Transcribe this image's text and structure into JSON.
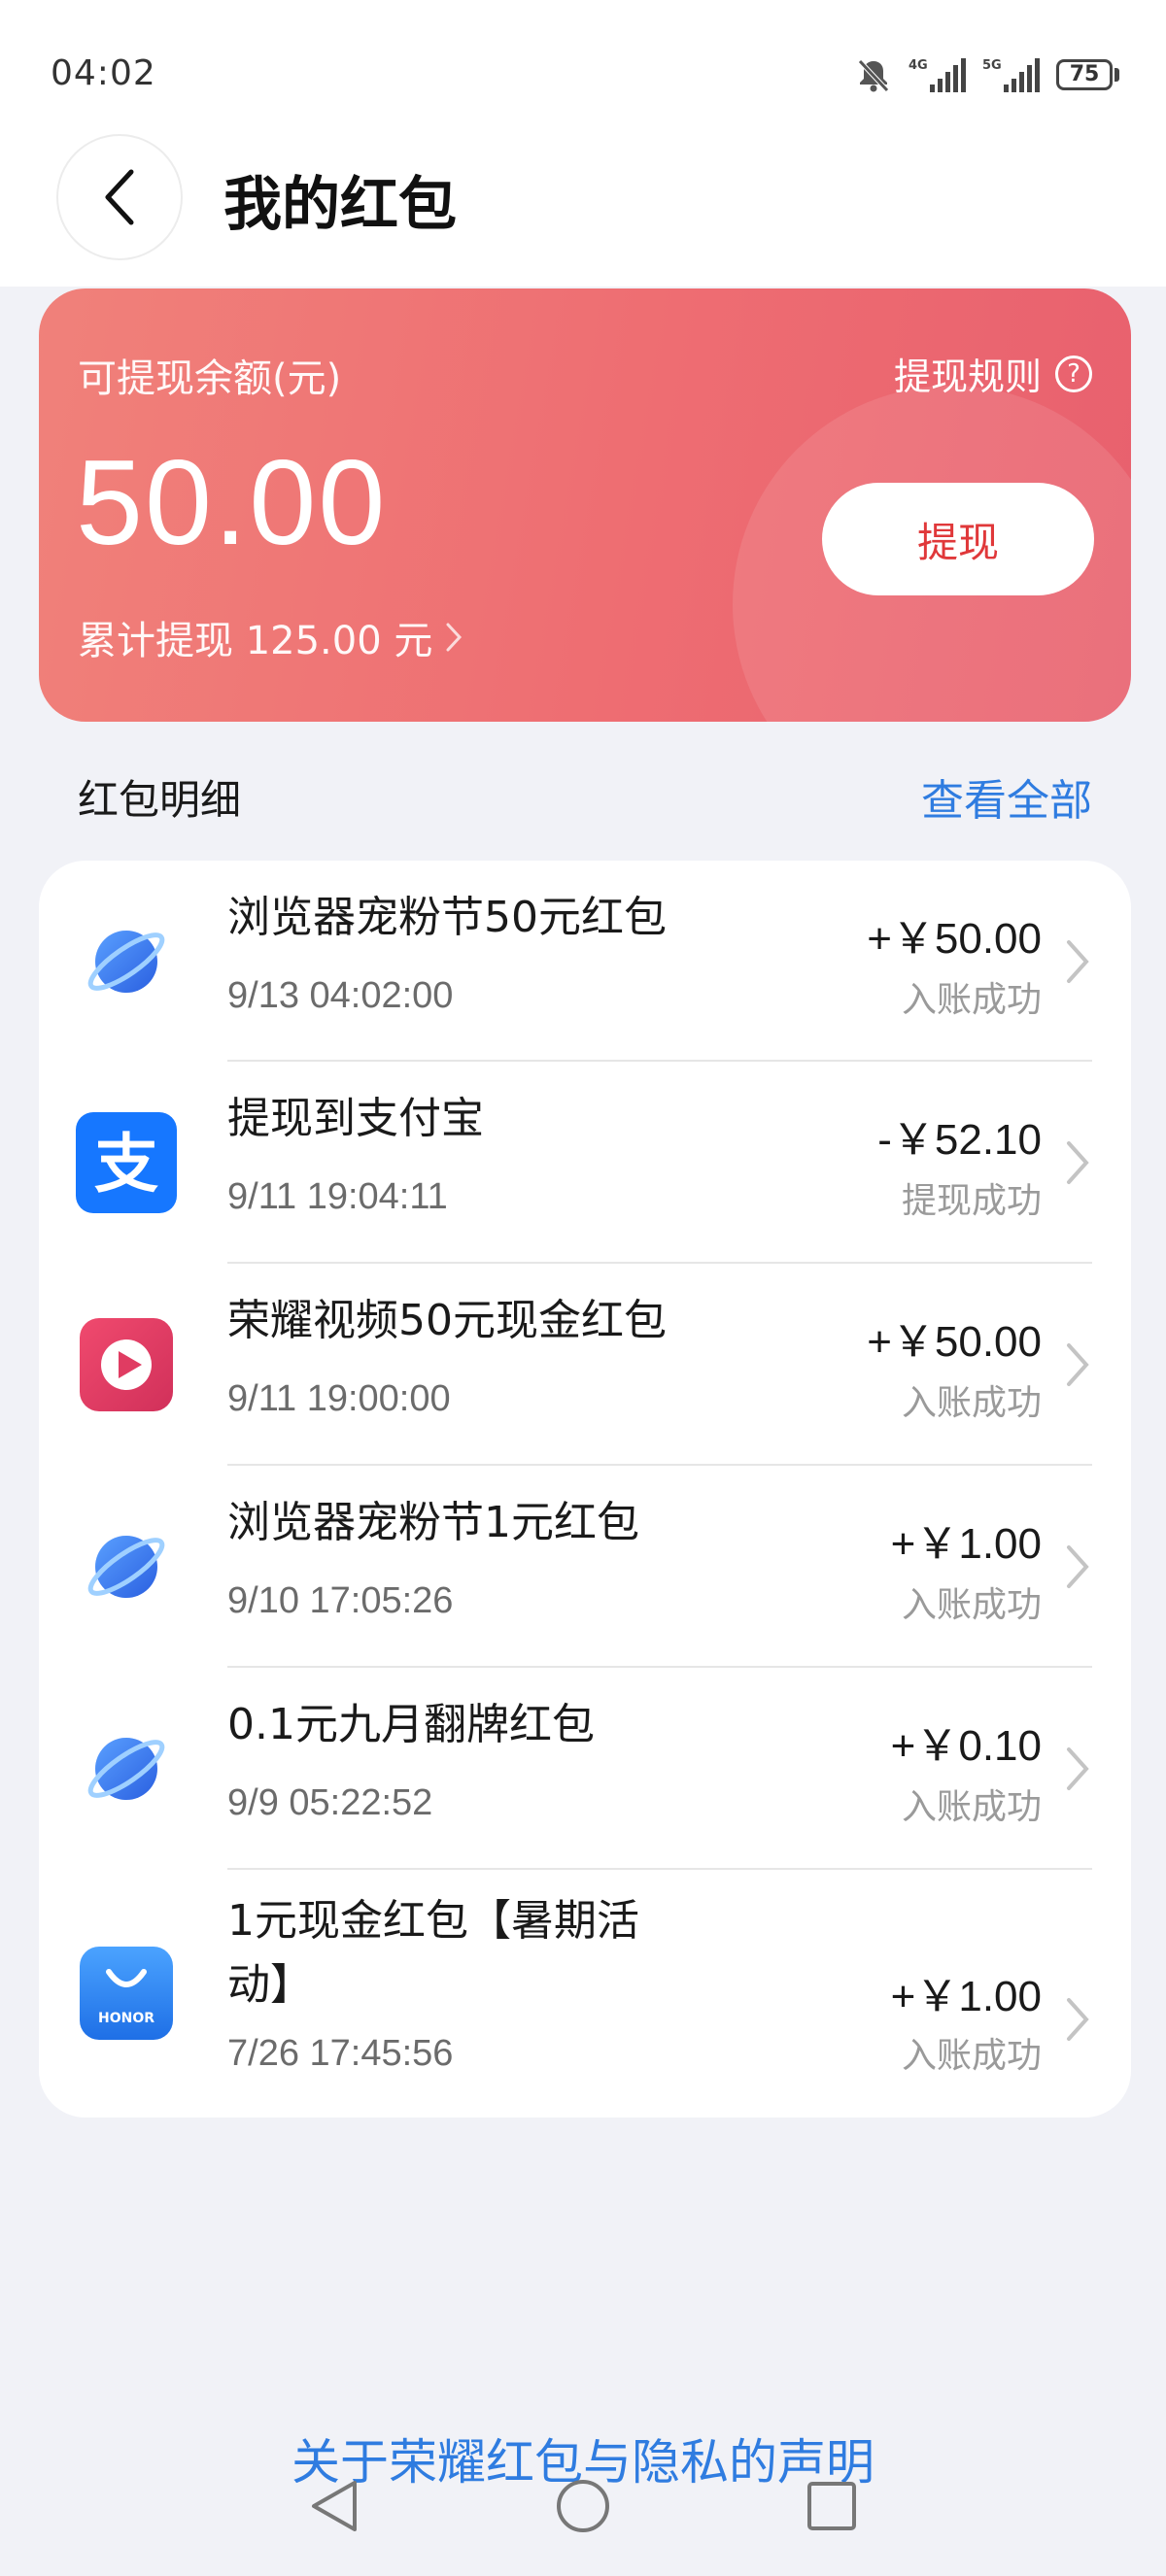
{
  "status_bar": {
    "time": "04:02",
    "battery": "75",
    "net1": "4G",
    "net2": "5G"
  },
  "header": {
    "title": "我的红包"
  },
  "balance_card": {
    "label": "可提现余额(元)",
    "rules_label": "提现规则",
    "amount": "50.00",
    "cumulative": "累计提现 125.00 元",
    "withdraw_label": "提现"
  },
  "details": {
    "title": "红包明细",
    "view_all": "查看全部",
    "items": [
      {
        "icon": "browser-planet-icon",
        "title": "浏览器宠粉节50元红包",
        "title2": "",
        "date": "9/13 04:02:00",
        "amount": "+￥50.00",
        "status": "入账成功"
      },
      {
        "icon": "alipay-icon",
        "title": "提现到支付宝",
        "title2": "",
        "date": "9/11 19:04:11",
        "amount": "-￥52.10",
        "status": "提现成功"
      },
      {
        "icon": "honor-video-icon",
        "title": "荣耀视频50元现金红包",
        "title2": "",
        "date": "9/11 19:00:00",
        "amount": "+￥50.00",
        "status": "入账成功"
      },
      {
        "icon": "browser-planet-icon",
        "title": "浏览器宠粉节1元红包",
        "title2": "",
        "date": "9/10 17:05:26",
        "amount": "+￥1.00",
        "status": "入账成功"
      },
      {
        "icon": "browser-planet-icon",
        "title": "0.1元九月翻牌红包",
        "title2": "",
        "date": "9/9 05:22:52",
        "amount": "+￥0.10",
        "status": "入账成功"
      },
      {
        "icon": "honor-store-icon",
        "title": "1元现金红包【暑期活",
        "title2": "动】",
        "date": "7/26 17:45:56",
        "amount": "+￥1.00",
        "status": "入账成功"
      }
    ]
  },
  "footer": {
    "privacy_link": "关于荣耀红包与隐私的声明",
    "honor_text": "HONOR"
  },
  "colors": {
    "card_gradient_start": "#f0817a",
    "card_gradient_end": "#e8606e",
    "link_blue": "#2f7ce0",
    "withdraw_text": "#e0383a",
    "page_bg": "#f1f2f7"
  }
}
